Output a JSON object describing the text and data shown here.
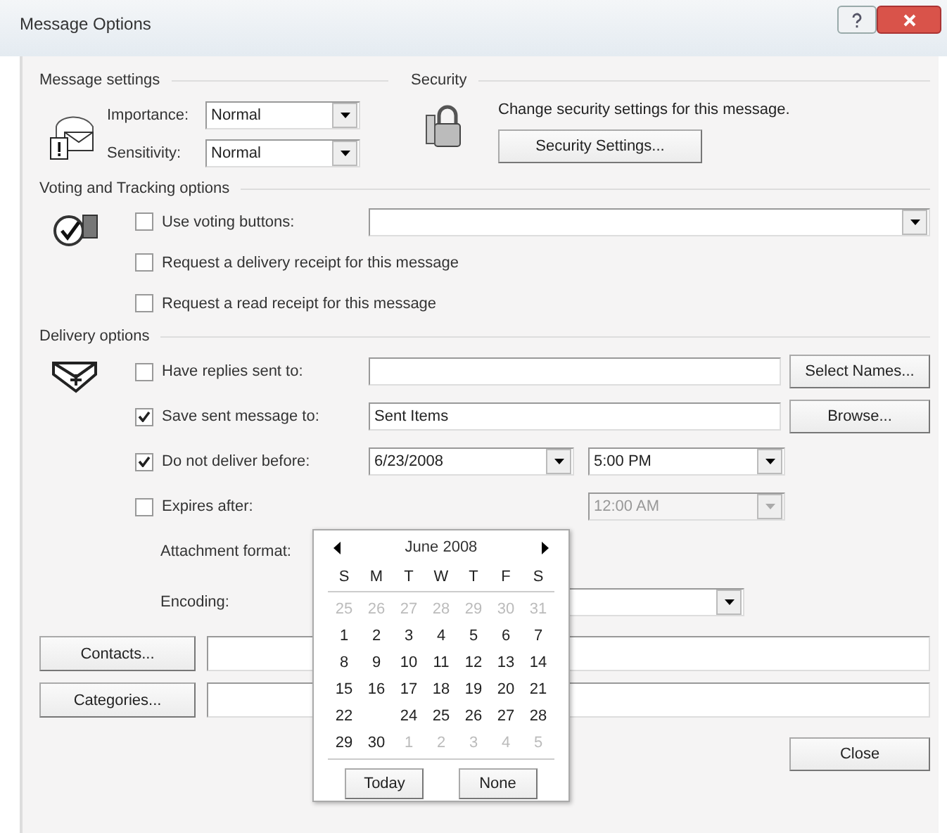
{
  "window": {
    "title": "Message Options"
  },
  "title_buttons": [
    {
      "kind": "help"
    },
    {
      "kind": "close"
    }
  ],
  "message_settings": {
    "heading": "Message settings",
    "fields": [
      {
        "label": "Importance:",
        "value": "Normal"
      },
      {
        "label": "Sensitivity:",
        "value": "Normal"
      }
    ]
  },
  "security": {
    "heading": "Security",
    "text": "Change security settings for this message.",
    "button": "Security Settings..."
  },
  "voting": {
    "heading": "Voting and Tracking options",
    "options": [
      {
        "kind": "dropdown",
        "label": "Use voting buttons:",
        "checked": false
      },
      {
        "kind": "plain",
        "label": "Request a delivery receipt for this message",
        "checked": false
      },
      {
        "kind": "plain",
        "label": "Request a read receipt for this message",
        "checked": false
      }
    ]
  },
  "delivery": {
    "heading": "Delivery options",
    "rows": [
      {
        "kind": "text",
        "label": "Have replies sent to:",
        "checked": false,
        "button": "Select Names..."
      },
      {
        "kind": "text",
        "label": "Save sent message to:",
        "checked": true,
        "value": "Sent Items",
        "button": "Browse..."
      },
      {
        "kind": "datetime",
        "label": "Do not deliver before:",
        "checked": true,
        "date": "6/23/2008",
        "time": "5:00 PM"
      },
      {
        "kind": "datetime",
        "label": "Expires after:",
        "checked": false,
        "time": "12:00 AM"
      },
      {
        "kind": "label",
        "label": "Attachment format:"
      },
      {
        "kind": "select",
        "label": "Encoding:"
      }
    ]
  },
  "contacts": {
    "button": "Contacts..."
  },
  "categories": {
    "button": "Categories..."
  },
  "calendar": {
    "month": "June 2008",
    "weekdays": [
      "S",
      "M",
      "T",
      "W",
      "T",
      "F",
      "S"
    ],
    "days": [
      {
        "day": "25",
        "kind": "other"
      },
      {
        "day": "26",
        "kind": "other"
      },
      {
        "day": "27",
        "kind": "other"
      },
      {
        "day": "28",
        "kind": "other"
      },
      {
        "day": "29",
        "kind": "other"
      },
      {
        "day": "30",
        "kind": "other"
      },
      {
        "day": "31",
        "kind": "other"
      },
      {
        "day": "1",
        "kind": "month"
      },
      {
        "day": "2",
        "kind": "month"
      },
      {
        "day": "3",
        "kind": "month"
      },
      {
        "day": "4",
        "kind": "month"
      },
      {
        "day": "5",
        "kind": "month"
      },
      {
        "day": "6",
        "kind": "month"
      },
      {
        "day": "7",
        "kind": "month"
      },
      {
        "day": "8",
        "kind": "month"
      },
      {
        "day": "9",
        "kind": "month"
      },
      {
        "day": "10",
        "kind": "month"
      },
      {
        "day": "11",
        "kind": "month"
      },
      {
        "day": "12",
        "kind": "month"
      },
      {
        "day": "13",
        "kind": "month"
      },
      {
        "day": "14",
        "kind": "month"
      },
      {
        "day": "15",
        "kind": "month"
      },
      {
        "day": "16",
        "kind": "month"
      },
      {
        "day": "17",
        "kind": "month"
      },
      {
        "day": "18",
        "kind": "month"
      },
      {
        "day": "19",
        "kind": "month"
      },
      {
        "day": "20",
        "kind": "month"
      },
      {
        "day": "21",
        "kind": "month"
      },
      {
        "day": "22",
        "kind": "month"
      },
      {
        "kind": "blank"
      },
      {
        "day": "24",
        "kind": "month"
      },
      {
        "day": "25",
        "kind": "month"
      },
      {
        "day": "26",
        "kind": "month"
      },
      {
        "day": "27",
        "kind": "month"
      },
      {
        "day": "28",
        "kind": "month"
      },
      {
        "day": "29",
        "kind": "month"
      },
      {
        "day": "30",
        "kind": "month"
      },
      {
        "day": "1",
        "kind": "other"
      },
      {
        "day": "2",
        "kind": "other"
      },
      {
        "day": "3",
        "kind": "other"
      },
      {
        "day": "4",
        "kind": "other"
      },
      {
        "day": "5",
        "kind": "other"
      }
    ],
    "buttons": [
      "Today",
      "None"
    ]
  },
  "footer": {
    "button": "Close"
  }
}
